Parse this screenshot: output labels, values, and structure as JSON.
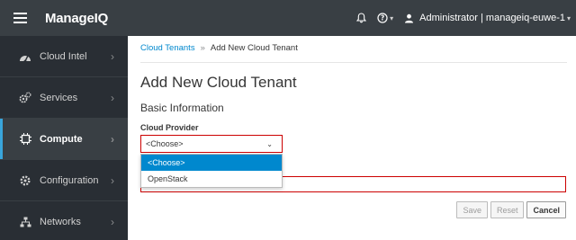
{
  "header": {
    "brand_prefix": "Manage",
    "brand_suffix": "IQ",
    "user_label": "Administrator | manageiq-euwe-1",
    "icons": [
      "hamburger-icon",
      "bell-icon",
      "help-icon",
      "user-icon"
    ]
  },
  "sidebar": {
    "items": [
      {
        "label": "Cloud Intel",
        "icon": "dashboard-icon"
      },
      {
        "label": "Services",
        "icon": "gears-icon"
      },
      {
        "label": "Compute",
        "icon": "chip-icon",
        "active": true
      },
      {
        "label": "Configuration",
        "icon": "gear-icon"
      },
      {
        "label": "Networks",
        "icon": "network-icon"
      }
    ]
  },
  "breadcrumb": {
    "parent": "Cloud Tenants",
    "separator": "»",
    "current": "Add New Cloud Tenant"
  },
  "page": {
    "title": "Add New Cloud Tenant",
    "section": "Basic Information",
    "provider_label": "Cloud Provider",
    "provider_value": "<Choose>",
    "provider_options": [
      "<Choose>",
      "OpenStack"
    ]
  },
  "buttons": {
    "save": "Save",
    "reset": "Reset",
    "cancel": "Cancel"
  },
  "colors": {
    "header_bg": "#393f44",
    "sidebar_bg": "#292e34",
    "accent": "#0088ce",
    "error_border": "#cc0000"
  }
}
